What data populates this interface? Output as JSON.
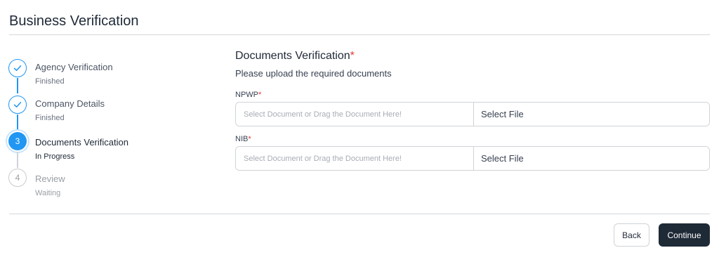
{
  "page": {
    "title": "Business Verification"
  },
  "stepper": {
    "steps": [
      {
        "number": "1",
        "title": "Agency Verification",
        "status": "Finished",
        "state": "finished"
      },
      {
        "number": "2",
        "title": "Company Details",
        "status": "Finished",
        "state": "finished"
      },
      {
        "number": "3",
        "title": "Documents Verification",
        "status": "In Progress",
        "state": "active"
      },
      {
        "number": "4",
        "title": "Review",
        "status": "Waiting",
        "state": "waiting"
      }
    ]
  },
  "form": {
    "title": "Documents Verification",
    "required_mark": "*",
    "subtitle": "Please upload the required documents",
    "fields": [
      {
        "label": "NPWP",
        "placeholder": "Select Document or Drag the Document Here!",
        "button": "Select File"
      },
      {
        "label": "NIB",
        "placeholder": "Select Document or Drag the Document Here!",
        "button": "Select File"
      }
    ]
  },
  "footer": {
    "back_label": "Back",
    "continue_label": "Continue"
  },
  "colors": {
    "accent": "#2196f3",
    "primary_button": "#1f2a37",
    "required": "#e53935"
  }
}
